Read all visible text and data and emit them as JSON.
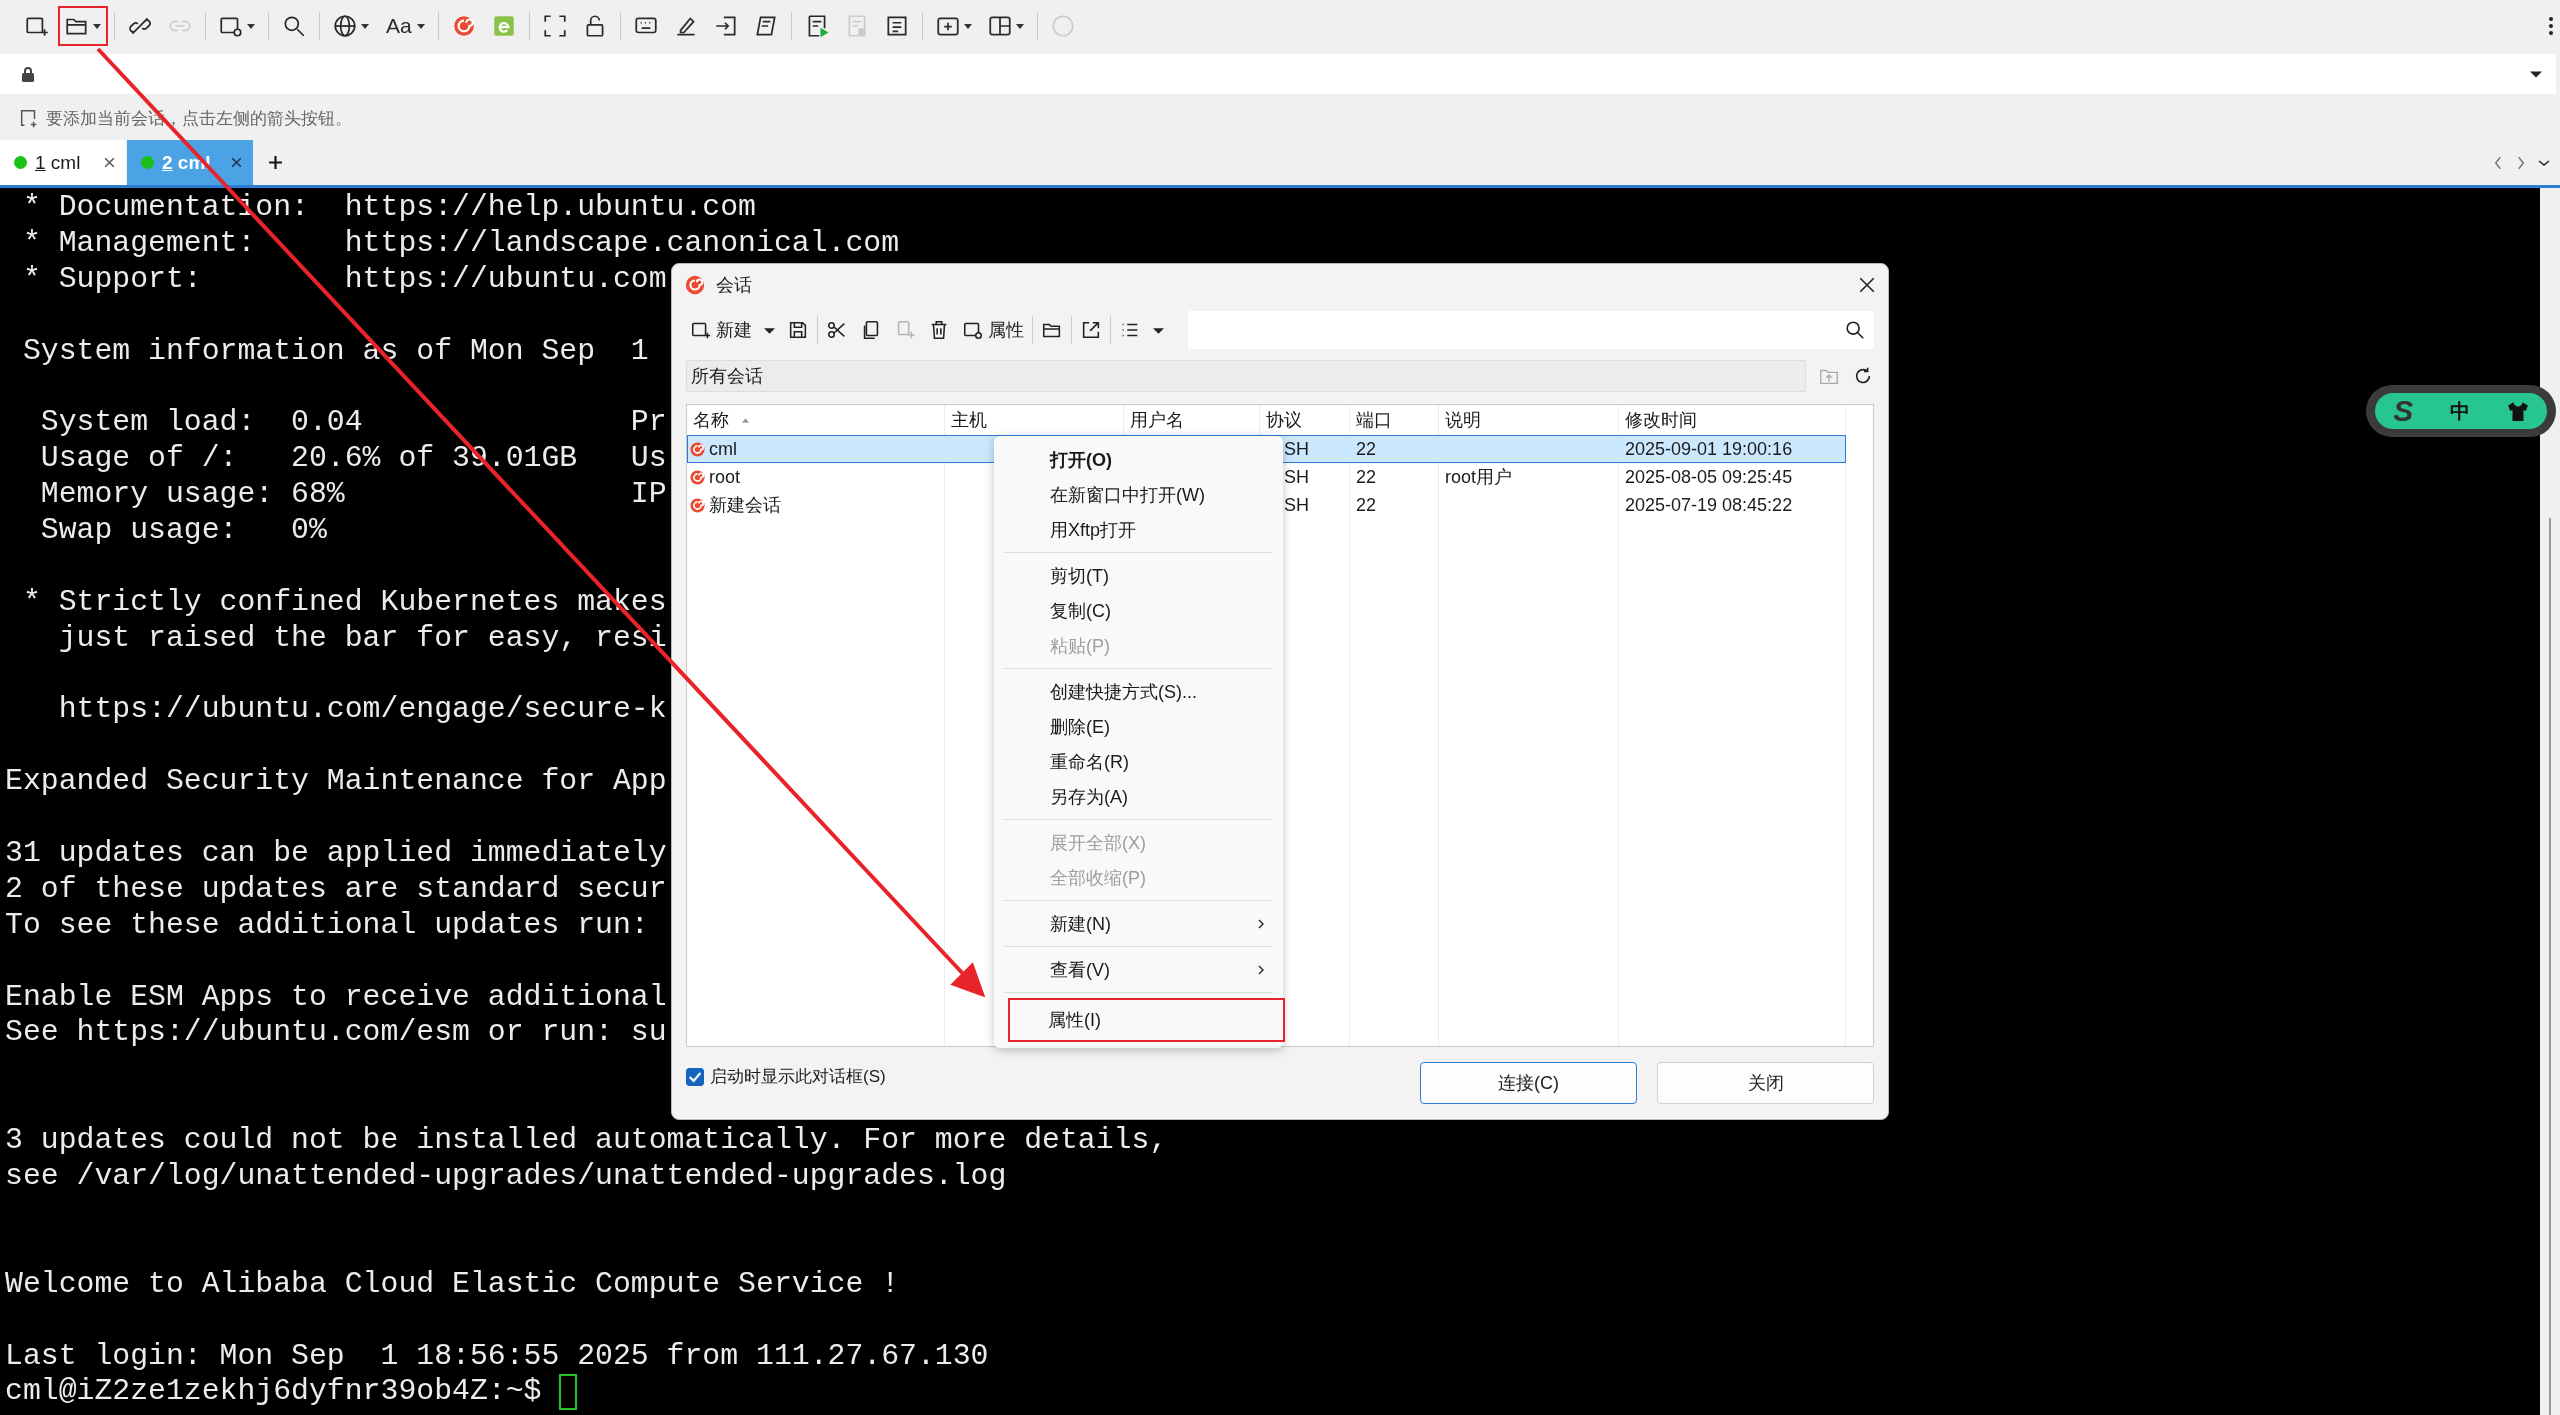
{
  "toolbar": [
    {
      "kind": "new-session",
      "dropdown": false,
      "disabled": false,
      "highlighted": false
    },
    {
      "kind": "open",
      "dropdown": true,
      "disabled": false,
      "highlighted": true
    },
    {
      "kind": "separator"
    },
    {
      "kind": "disconnect",
      "dropdown": false,
      "disabled": false,
      "highlighted": false
    },
    {
      "kind": "reconnect",
      "dropdown": false,
      "disabled": true,
      "highlighted": false
    },
    {
      "kind": "separator"
    },
    {
      "kind": "new-window",
      "dropdown": true,
      "disabled": false,
      "highlighted": false
    },
    {
      "kind": "separator"
    },
    {
      "kind": "search",
      "dropdown": false,
      "disabled": false,
      "highlighted": false
    },
    {
      "kind": "separator"
    },
    {
      "kind": "globe",
      "dropdown": true,
      "disabled": false,
      "highlighted": false
    },
    {
      "kind": "font",
      "label": "Aa",
      "dropdown": true,
      "disabled": false,
      "highlighted": false
    },
    {
      "kind": "separator"
    },
    {
      "kind": "xshell",
      "dropdown": false,
      "disabled": false,
      "highlighted": false
    },
    {
      "kind": "xftp",
      "dropdown": false,
      "disabled": false,
      "highlighted": false
    },
    {
      "kind": "separator"
    },
    {
      "kind": "fullscreen",
      "dropdown": false,
      "disabled": false,
      "highlighted": false
    },
    {
      "kind": "lock",
      "dropdown": false,
      "disabled": false,
      "highlighted": false
    },
    {
      "kind": "separator"
    },
    {
      "kind": "keyboard",
      "dropdown": false,
      "disabled": false,
      "highlighted": false
    },
    {
      "kind": "pen",
      "dropdown": false,
      "disabled": false,
      "highlighted": false
    },
    {
      "kind": "login",
      "dropdown": false,
      "disabled": false,
      "highlighted": false
    },
    {
      "kind": "script",
      "dropdown": false,
      "disabled": false,
      "highlighted": false
    },
    {
      "kind": "separator"
    },
    {
      "kind": "doc-play",
      "dropdown": false,
      "disabled": false,
      "highlighted": false
    },
    {
      "kind": "doc",
      "dropdown": false,
      "disabled": true,
      "highlighted": false
    },
    {
      "kind": "doc-list",
      "dropdown": false,
      "disabled": false,
      "highlighted": false
    },
    {
      "kind": "separator"
    },
    {
      "kind": "new-folder",
      "dropdown": true,
      "disabled": false,
      "highlighted": false
    },
    {
      "kind": "layout",
      "dropdown": true,
      "disabled": false,
      "highlighted": false
    },
    {
      "kind": "separator"
    },
    {
      "kind": "chat",
      "dropdown": false,
      "disabled": true,
      "highlighted": false
    }
  ],
  "hint": "要添加当前会话，点击左侧的箭头按钮。",
  "tabs": [
    {
      "number": "1",
      "label": "cml",
      "selected": false,
      "connected": true
    },
    {
      "number": "2",
      "label": "cml",
      "selected": true,
      "connected": true
    }
  ],
  "terminal": {
    "lines": [
      {
        "kind": "text",
        "text": " * Documentation:  https://help.ubuntu.com"
      },
      {
        "kind": "text",
        "text": " * Management:     https://landscape.canonical.com"
      },
      {
        "kind": "text",
        "text": " * Support:        https://ubuntu.com"
      },
      {
        "kind": "blank"
      },
      {
        "kind": "text",
        "text": " System information as of Mon Sep  1"
      },
      {
        "kind": "blank"
      },
      {
        "kind": "text",
        "text": "  System load:  0.04               Pr"
      },
      {
        "kind": "text",
        "text": "  Usage of /:   20.6% of 39.01GB   Us"
      },
      {
        "kind": "text",
        "text": "  Memory usage: 68%                IP"
      },
      {
        "kind": "text",
        "text": "  Swap usage:   0%"
      },
      {
        "kind": "blank"
      },
      {
        "kind": "text",
        "text": " * Strictly confined Kubernetes makes"
      },
      {
        "kind": "text",
        "text": "   just raised the bar for easy, resi"
      },
      {
        "kind": "blank"
      },
      {
        "kind": "text",
        "text": "   https://ubuntu.com/engage/secure-k"
      },
      {
        "kind": "blank"
      },
      {
        "kind": "text",
        "text": "Expanded Security Maintenance for App"
      },
      {
        "kind": "blank"
      },
      {
        "kind": "text",
        "text": "31 updates can be applied immediately"
      },
      {
        "kind": "text",
        "text": "2 of these updates are standard secur"
      },
      {
        "kind": "text",
        "text": "To see these additional updates run:"
      },
      {
        "kind": "blank"
      },
      {
        "kind": "text",
        "text": "Enable ESM Apps to receive additional"
      },
      {
        "kind": "text",
        "text": "See https://ubuntu.com/esm or run: su"
      },
      {
        "kind": "blank"
      },
      {
        "kind": "blank"
      },
      {
        "kind": "text",
        "text": "3 updates could not be installed automatically. For more details,"
      },
      {
        "kind": "text",
        "text": "see /var/log/unattended-upgrades/unattended-upgrades.log"
      },
      {
        "kind": "blank"
      },
      {
        "kind": "blank"
      },
      {
        "kind": "text",
        "text": "Welcome to Alibaba Cloud Elastic Compute Service !"
      },
      {
        "kind": "blank"
      },
      {
        "kind": "text",
        "text": "Last login: Mon Sep  1 18:56:55 2025 from 111.27.67.130"
      }
    ],
    "prompt": "cml@iZ2ze1zekhj6dyfnr39ob4Z:~$ "
  },
  "widget": {
    "logo": "S",
    "language": "中"
  },
  "dialog": {
    "title": "会话",
    "toolbar": [
      {
        "kind": "new",
        "label": "新建",
        "dropdown": true,
        "disabled": false
      },
      {
        "kind": "save",
        "dropdown": false,
        "disabled": false
      },
      {
        "kind": "separator"
      },
      {
        "kind": "cut",
        "dropdown": false,
        "disabled": false
      },
      {
        "kind": "copy",
        "dropdown": false,
        "disabled": false
      },
      {
        "kind": "paste",
        "dropdown": false,
        "disabled": true
      },
      {
        "kind": "delete",
        "dropdown": false,
        "disabled": false
      },
      {
        "kind": "properties",
        "label": "属性",
        "dropdown": false,
        "disabled": false
      },
      {
        "kind": "separator"
      },
      {
        "kind": "folder",
        "dropdown": false,
        "disabled": false
      },
      {
        "kind": "separator"
      },
      {
        "kind": "export",
        "dropdown": false,
        "disabled": false
      },
      {
        "kind": "separator"
      },
      {
        "kind": "view",
        "dropdown": true,
        "disabled": false
      }
    ],
    "path": "所有会话",
    "columns": [
      "名称",
      "主机",
      "用户名",
      "协议",
      "端口",
      "说明",
      "修改时间"
    ],
    "sessions": [
      {
        "name": "cml",
        "protocol": "SH",
        "port": "22",
        "modified": "2025-09-01 19:00:16",
        "selected": true
      },
      {
        "name": "root",
        "protocol": "SH",
        "port": "22",
        "description": "root用户",
        "modified": "2025-08-05 09:25:45",
        "selected": false
      },
      {
        "name": "新建会话",
        "protocol": "SH",
        "port": "22",
        "modified": "2025-07-19 08:45:22",
        "selected": false
      }
    ],
    "context_menu": [
      [
        {
          "label": "打开(O)",
          "default": true,
          "disabled": false,
          "submenu": false,
          "highlighted": false
        },
        {
          "label": "在新窗口中打开(W)",
          "default": false,
          "disabled": false,
          "submenu": false,
          "highlighted": false
        },
        {
          "label": "用Xftp打开",
          "default": false,
          "disabled": false,
          "submenu": false,
          "highlighted": false
        }
      ],
      [
        {
          "label": "剪切(T)",
          "default": false,
          "disabled": false,
          "submenu": false,
          "highlighted": false
        },
        {
          "label": "复制(C)",
          "default": false,
          "disabled": false,
          "submenu": false,
          "highlighted": false
        },
        {
          "label": "粘贴(P)",
          "default": false,
          "disabled": true,
          "submenu": false,
          "highlighted": false
        }
      ],
      [
        {
          "label": "创建快捷方式(S)...",
          "default": false,
          "disabled": false,
          "submenu": false,
          "highlighted": false
        },
        {
          "label": "删除(E)",
          "default": false,
          "disabled": false,
          "submenu": false,
          "highlighted": false
        },
        {
          "label": "重命名(R)",
          "default": false,
          "disabled": false,
          "submenu": false,
          "highlighted": false
        },
        {
          "label": "另存为(A)",
          "default": false,
          "disabled": false,
          "submenu": false,
          "highlighted": false
        }
      ],
      [
        {
          "label": "展开全部(X)",
          "default": false,
          "disabled": true,
          "submenu": false,
          "highlighted": false
        },
        {
          "label": "全部收缩(P)",
          "default": false,
          "disabled": true,
          "submenu": false,
          "highlighted": false
        }
      ],
      [
        {
          "label": "新建(N)",
          "default": false,
          "disabled": false,
          "submenu": true,
          "highlighted": false
        }
      ],
      [
        {
          "label": "查看(V)",
          "default": false,
          "disabled": false,
          "submenu": true,
          "highlighted": false
        }
      ],
      [
        {
          "label": "属性(I)",
          "default": false,
          "disabled": false,
          "submenu": false,
          "highlighted": true
        }
      ]
    ],
    "show_on_startup": {
      "label": "启动时显示此对话框(S)",
      "checked": true
    },
    "buttons": [
      {
        "label": "连接(C)",
        "default": true
      },
      {
        "label": "关闭",
        "default": false
      }
    ]
  },
  "annotation": {
    "arrow": true
  }
}
